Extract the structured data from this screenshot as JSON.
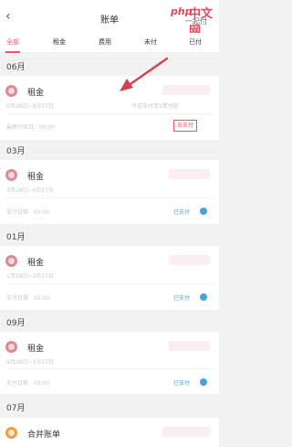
{
  "header": {
    "back_icon": "chevron-left-icon",
    "title": "账单"
  },
  "watermark": {
    "logo_php": "php",
    "logo_cn": "中文网",
    "sub_text": "一起付"
  },
  "tabs": [
    {
      "label": "全部",
      "active": true
    },
    {
      "label": "租金",
      "active": false
    },
    {
      "label": "费用",
      "active": false
    },
    {
      "label": "未付",
      "active": false
    },
    {
      "label": "已付",
      "active": false
    }
  ],
  "bills": [
    {
      "month": "06月",
      "name": "租金",
      "period": "6月28日~9月27日",
      "note": "今日支付请1笔付款",
      "due_text": "最晚付款日 · 00:00",
      "status": "去支付"
    },
    {
      "month": "03月",
      "name": "租金",
      "period": "3月28日~6月27日",
      "due_text": "支付日期 · 00:00",
      "status": "已支付"
    },
    {
      "month": "01月",
      "name": "租金",
      "period": "1月28日~3月27日",
      "due_text": "支付日期 · 00:00",
      "status": "已支付"
    },
    {
      "month": "09月",
      "name": "租金",
      "period": "9月28日~1月27日",
      "due_text": "支付日期 · 00:00",
      "status": "已支付"
    },
    {
      "month": "07月",
      "name": "合并账单"
    }
  ],
  "colors": {
    "accent": "#e85a6a",
    "paid": "#45a5d8",
    "arrow": "#d4424f"
  }
}
